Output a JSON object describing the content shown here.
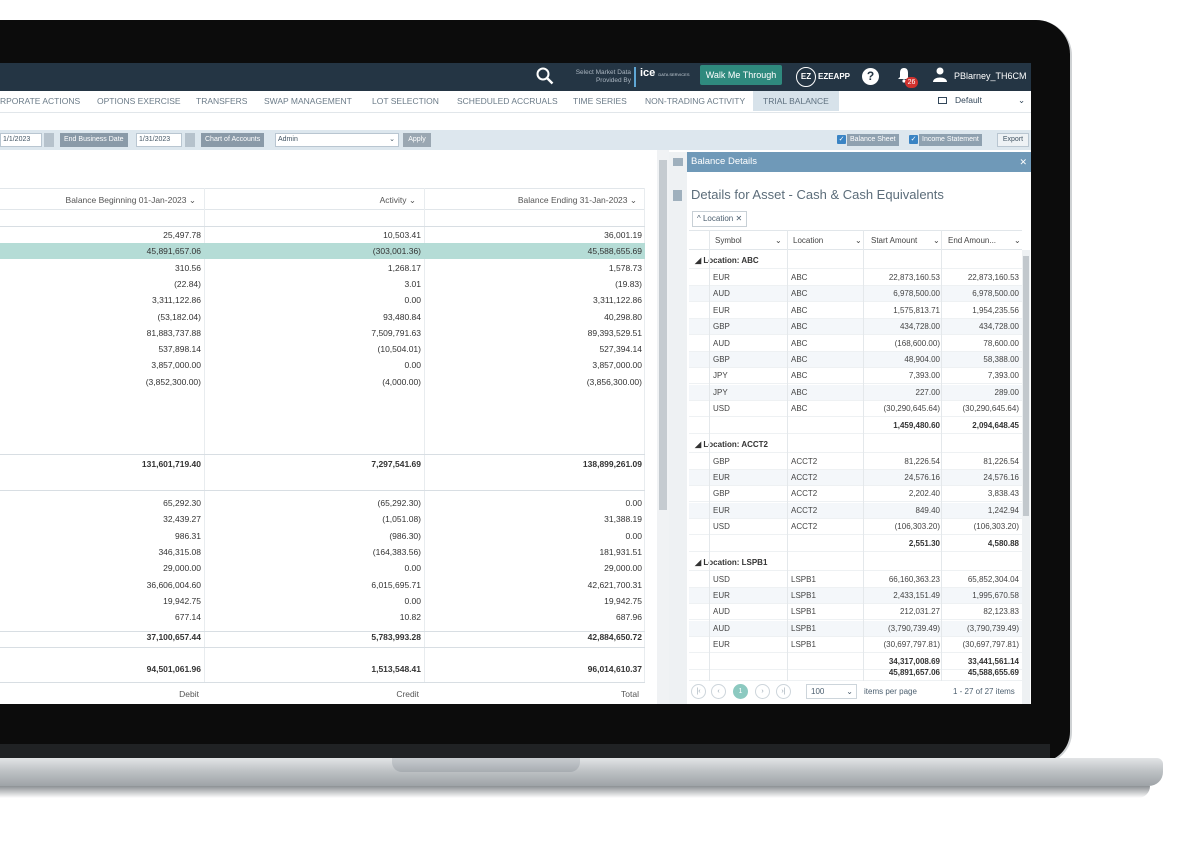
{
  "topbar": {
    "market_data_label_1": "Select Market Data",
    "market_data_label_2": "Provided By",
    "ice_logo": "ice",
    "ice_sub": "DATA SERVICES",
    "walk_button": "Walk Me Through",
    "eze_app": "EZEAPP",
    "notifications_count": "26",
    "user_name": "PBlarney_TH6CM"
  },
  "tabs": [
    {
      "label": "RPORATE ACTIONS"
    },
    {
      "label": "OPTIONS EXERCISE"
    },
    {
      "label": "TRANSFERS"
    },
    {
      "label": "SWAP MANAGEMENT"
    },
    {
      "label": "LOT SELECTION"
    },
    {
      "label": "SCHEDULED ACCRUALS"
    },
    {
      "label": "TIME SERIES"
    },
    {
      "label": "NON-TRADING ACTIVITY"
    },
    {
      "label": "TRIAL BALANCE",
      "active": true
    }
  ],
  "layout_select": "Default",
  "filters": {
    "start_date": "1/1/2023",
    "end_label": "End Business Date",
    "end_date": "1/31/2023",
    "coa_label": "Chart of Accounts",
    "coa_value": "Admin",
    "apply": "Apply",
    "balance_sheet": "Balance Sheet",
    "income_statement": "Income Statement",
    "export": "Export"
  },
  "grid": {
    "headers": {
      "begin": "Balance Beginning 01-Jan-2023",
      "activity": "Activity",
      "end": "Balance Ending 31-Jan-2023"
    },
    "rows_a": [
      {
        "b": "25,497.78",
        "a": "10,503.41",
        "e": "36,001.19"
      },
      {
        "b": "45,891,657.06",
        "a": "(303,001.36)",
        "e": "45,588,655.69"
      },
      {
        "b": "310.56",
        "a": "1,268.17",
        "e": "1,578.73"
      },
      {
        "b": "(22.84)",
        "a": "3.01",
        "e": "(19.83)"
      },
      {
        "b": "3,311,122.86",
        "a": "0.00",
        "e": "3,311,122.86"
      },
      {
        "b": "(53,182.04)",
        "a": "93,480.84",
        "e": "40,298.80"
      },
      {
        "b": "81,883,737.88",
        "a": "7,509,791.63",
        "e": "89,393,529.51"
      },
      {
        "b": "537,898.14",
        "a": "(10,504.01)",
        "e": "527,394.14"
      },
      {
        "b": "3,857,000.00",
        "a": "0.00",
        "e": "3,857,000.00"
      },
      {
        "b": "(3,852,300.00)",
        "a": "(4,000.00)",
        "e": "(3,856,300.00)"
      }
    ],
    "total_a": {
      "b": "131,601,719.40",
      "a": "7,297,541.69",
      "e": "138,899,261.09"
    },
    "rows_b": [
      {
        "b": "65,292.30",
        "a": "(65,292.30)",
        "e": "0.00"
      },
      {
        "b": "32,439.27",
        "a": "(1,051.08)",
        "e": "31,388.19"
      },
      {
        "b": "986.31",
        "a": "(986.30)",
        "e": "0.00"
      },
      {
        "b": "346,315.08",
        "a": "(164,383.56)",
        "e": "181,931.51"
      },
      {
        "b": "29,000.00",
        "a": "0.00",
        "e": "29,000.00"
      },
      {
        "b": "36,606,004.60",
        "a": "6,015,695.71",
        "e": "42,621,700.31"
      },
      {
        "b": "19,942.75",
        "a": "0.00",
        "e": "19,942.75"
      },
      {
        "b": "677.14",
        "a": "10.82",
        "e": "687.96"
      }
    ],
    "total_b": {
      "b": "37,100,657.44",
      "a": "5,783,993.28",
      "e": "42,884,650.72"
    },
    "grand_total": {
      "b": "94,501,061.96",
      "a": "1,513,548.41",
      "e": "96,014,610.37"
    },
    "footer": {
      "debit": "Debit",
      "credit": "Credit",
      "total": "Total"
    }
  },
  "panel": {
    "header": "Balance Details",
    "title": "Details for Asset - Cash & Cash Equivalents",
    "chip": "Location",
    "columns": [
      "Symbol",
      "Location",
      "Start Amount",
      "End Amoun..."
    ],
    "groups": [
      {
        "label": "Location: ABC",
        "rows": [
          [
            "EUR",
            "ABC",
            "22,873,160.53",
            "22,873,160.53"
          ],
          [
            "AUD",
            "ABC",
            "6,978,500.00",
            "6,978,500.00"
          ],
          [
            "EUR",
            "ABC",
            "1,575,813.71",
            "1,954,235.56"
          ],
          [
            "GBP",
            "ABC",
            "434,728.00",
            "434,728.00"
          ],
          [
            "AUD",
            "ABC",
            "(168,600.00)",
            "78,600.00"
          ],
          [
            "GBP",
            "ABC",
            "48,904.00",
            "58,388.00"
          ],
          [
            "JPY",
            "ABC",
            "7,393.00",
            "7,393.00"
          ],
          [
            "JPY",
            "ABC",
            "227.00",
            "289.00"
          ],
          [
            "USD",
            "ABC",
            "(30,290,645.64)",
            "(30,290,645.64)"
          ]
        ],
        "subtotal": [
          "1,459,480.60",
          "2,094,648.45"
        ]
      },
      {
        "label": "Location: ACCT2",
        "rows": [
          [
            "GBP",
            "ACCT2",
            "81,226.54",
            "81,226.54"
          ],
          [
            "EUR",
            "ACCT2",
            "24,576.16",
            "24,576.16"
          ],
          [
            "GBP",
            "ACCT2",
            "2,202.40",
            "3,838.43"
          ],
          [
            "EUR",
            "ACCT2",
            "849.40",
            "1,242.94"
          ],
          [
            "USD",
            "ACCT2",
            "(106,303.20)",
            "(106,303.20)"
          ]
        ],
        "subtotal": [
          "2,551.30",
          "4,580.88"
        ]
      },
      {
        "label": "Location: LSPB1",
        "rows": [
          [
            "USD",
            "LSPB1",
            "66,160,363.23",
            "65,852,304.04"
          ],
          [
            "EUR",
            "LSPB1",
            "2,433,151.49",
            "1,995,670.58"
          ],
          [
            "AUD",
            "LSPB1",
            "212,031.27",
            "82,123.83"
          ],
          [
            "AUD",
            "LSPB1",
            "(3,790,739.49)",
            "(3,790,739.49)"
          ],
          [
            "EUR",
            "LSPB1",
            "(30,697,797.81)",
            "(30,697,797.81)"
          ]
        ],
        "subtotal": [
          "34,317,008.69",
          "33,441,561.14"
        ]
      }
    ],
    "grand_total": [
      "45,891,657.06",
      "45,588,655.69"
    ],
    "pager": {
      "current_page": "1",
      "page_size": "100",
      "items_label": "items per page",
      "range": "1 - 27 of 27 items"
    }
  }
}
